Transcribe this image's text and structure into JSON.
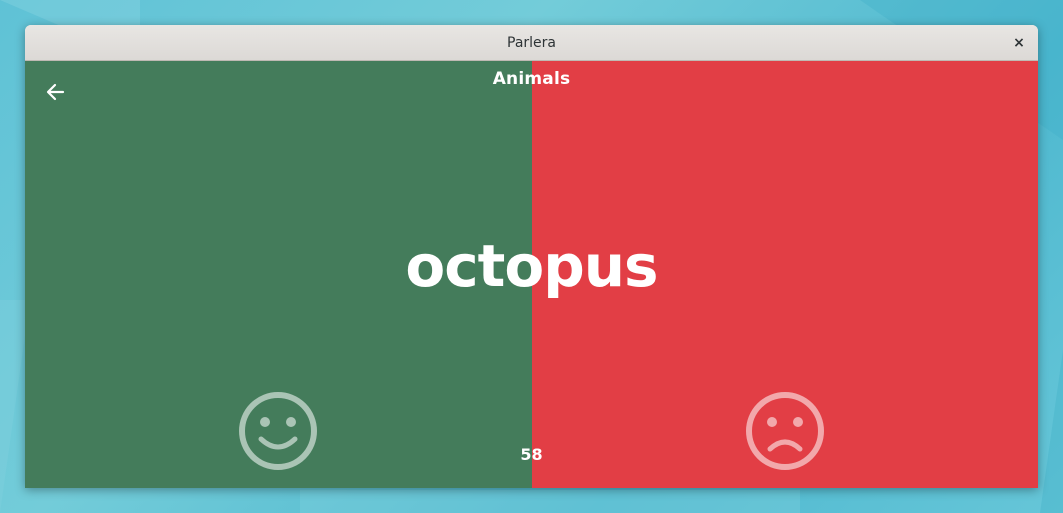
{
  "window": {
    "title": "Parlera",
    "close_label": "×"
  },
  "game": {
    "category": "Animals",
    "word": "octopus",
    "timer": "58",
    "correct_color": "#447c5b",
    "wrong_color": "#e23e45"
  },
  "icons": {
    "back": "arrow-left-icon",
    "correct": "smiley-face-icon",
    "wrong": "frowning-face-icon",
    "close": "close-icon"
  }
}
